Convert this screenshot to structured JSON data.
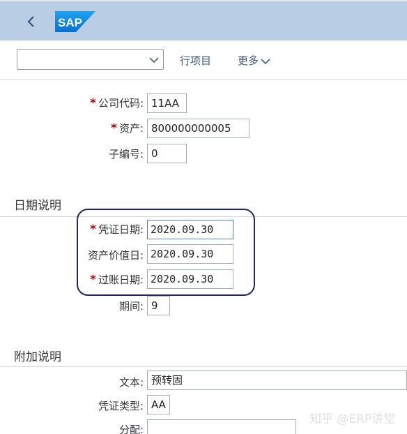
{
  "toolbar": {
    "select_value": "",
    "line_items_label": "行项目",
    "more_label": "更多"
  },
  "header_fields": {
    "company_code": {
      "label": "公司代码:",
      "value": "11AA",
      "required": true
    },
    "asset": {
      "label": "资产:",
      "value": "800000000005",
      "required": true
    },
    "sub_number": {
      "label": "子编号:",
      "value": "0",
      "required": false
    }
  },
  "dates_section": {
    "title": "日期说明",
    "document_date": {
      "label": "凭证日期:",
      "value": "2020.09.30",
      "required": true
    },
    "asset_value_date": {
      "label": "资产价值日:",
      "value": "2020.09.30",
      "required": false
    },
    "posting_date": {
      "label": "过账日期:",
      "value": "2020.09.30",
      "required": true
    },
    "period": {
      "label": "期间:",
      "value": "9",
      "required": false
    }
  },
  "additional_section": {
    "title": "附加说明",
    "text": {
      "label": "文本:",
      "value": "预转固"
    },
    "document_type": {
      "label": "凭证类型:",
      "value": "AA"
    },
    "assignment": {
      "label": "分配:",
      "value": ""
    }
  },
  "required_marker": "*",
  "watermark": "知乎 @ERP讲堂",
  "colors": {
    "shell": "#b9cde4",
    "required": "#bb0000",
    "highlight_border": "#1c2a5e",
    "sap_logo_blue": "#0a6ed1"
  },
  "icons": {
    "back": "chevron-left-icon",
    "select": "chevron-down-icon",
    "more": "chevron-down-icon"
  }
}
